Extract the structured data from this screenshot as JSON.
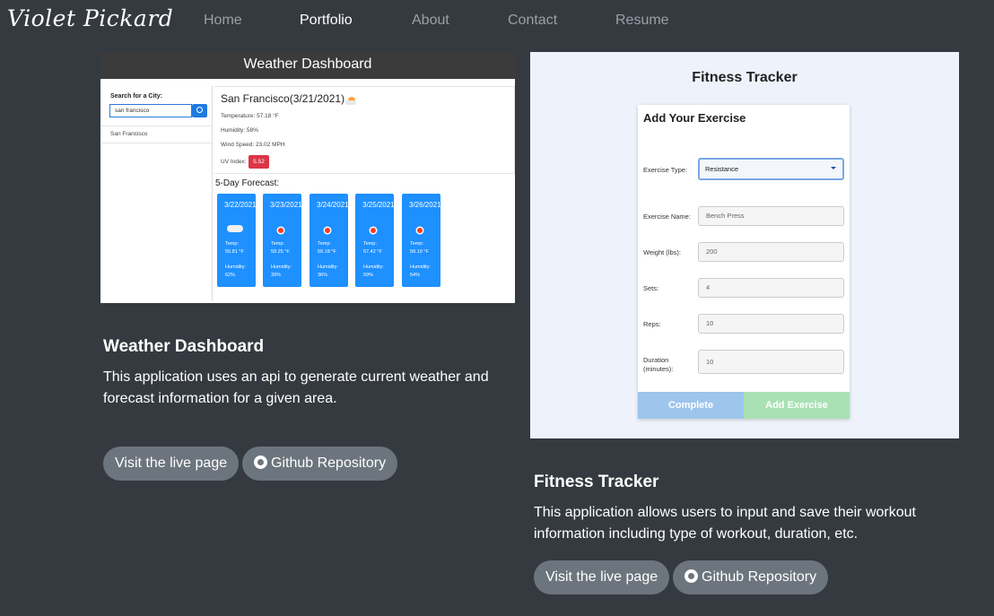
{
  "nav": {
    "brand": "Violet Pickard",
    "links": [
      "Home",
      "Portfolio",
      "About",
      "Contact",
      "Resume"
    ],
    "active": "Portfolio"
  },
  "projects": [
    {
      "title": "Weather Dashboard",
      "description": "This application uses an api to generate current weather and forecast information for a given area.",
      "live_label": "Visit the live page",
      "repo_label": "Github Repository",
      "screenshot": {
        "header": "Weather Dashboard",
        "search_label": "Search for a City:",
        "search_value": "san francisco",
        "history": [
          "San Francisco"
        ],
        "current_title": "San Francisco(3/21/2021)",
        "temperature": "Temperature: 57.18 °F",
        "humidity": "Humidity: 58%",
        "wind": "Wind Speed: 23.02 MPH",
        "uv_label": "UV Index:",
        "uv_value": "5.52",
        "forecast_label": "5-Day Forecast:",
        "forecast": [
          {
            "date": "3/22/2021",
            "icon": "cloud-icon",
            "temp": "Temp: 55.81 °F",
            "humidity": "Humidity: 62%"
          },
          {
            "date": "3/23/2021",
            "icon": "sun-icon",
            "temp": "Temp: 59.25 °F",
            "humidity": "Humidity: 39%"
          },
          {
            "date": "3/24/2021",
            "icon": "sun-icon",
            "temp": "Temp: 59.18 °F",
            "humidity": "Humidity: 36%"
          },
          {
            "date": "3/25/2021",
            "icon": "sun-icon",
            "temp": "Temp: 57.42 °F",
            "humidity": "Humidity: 59%"
          },
          {
            "date": "3/26/2021",
            "icon": "sun-icon",
            "temp": "Temp: 58.19 °F",
            "humidity": "Humidity: 54%"
          }
        ]
      }
    },
    {
      "title": "Fitness Tracker",
      "description": "This application allows users to input and save their workout information including type of workout, duration, etc.",
      "live_label": "Visit the live page",
      "repo_label": "Github Repository",
      "screenshot": {
        "title": "Fitness Tracker",
        "heading": "Add Your Exercise",
        "exercise_type_label": "Exercise Type:",
        "exercise_type_value": "Resistance",
        "exercise_name_label": "Exercise Name:",
        "exercise_name_value": "Bench Press",
        "weight_label": "Weight (lbs):",
        "weight_value": "200",
        "sets_label": "Sets:",
        "sets_value": "4",
        "reps_label": "Reps:",
        "reps_value": "10",
        "duration_label": "Duration (minutes):",
        "duration_value": "10",
        "complete_label": "Complete",
        "add_label": "Add Exercise"
      }
    }
  ],
  "colors": {
    "background": "#343a40",
    "button": "#6c757d",
    "forecast_card": "#1e90ff",
    "uv_badge": "#dc3545"
  }
}
